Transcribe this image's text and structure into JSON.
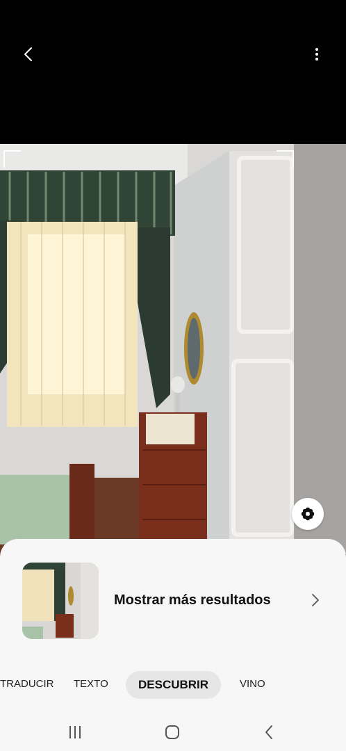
{
  "header": {
    "back_icon": "chevron-left-icon",
    "menu_icon": "more-vertical-icon"
  },
  "lens_button_icon": "flower-icon",
  "result": {
    "label": "Mostrar más resultados",
    "arrow_icon": "chevron-right-icon"
  },
  "modes": [
    {
      "label": "TRADUCIR",
      "active": false
    },
    {
      "label": "TEXTO",
      "active": false
    },
    {
      "label": "DESCUBRIR",
      "active": true
    },
    {
      "label": "VINO",
      "active": false
    }
  ],
  "navbar": {
    "recents_icon": "recents-icon",
    "home_icon": "home-icon",
    "back_icon": "back-icon"
  },
  "colors": {
    "sheet": "#f7f7f7",
    "active_chip": "#e6e6e6",
    "text": "#111111"
  }
}
